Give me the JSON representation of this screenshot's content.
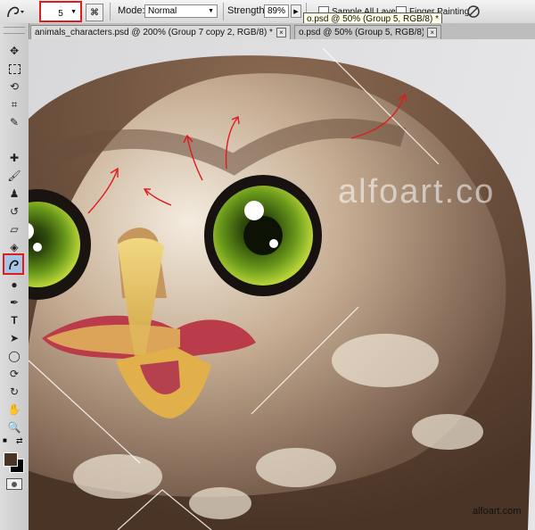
{
  "options_bar": {
    "brush_size": "5",
    "mode_label": "Mode:",
    "mode_value": "Normal",
    "strength_label": "Strength:",
    "strength_value": "89%",
    "sample_all_layers": "Sample All Layers",
    "finger_painting": "Finger Painting"
  },
  "tooltip": "o.psd @ 50% (Group 5, RGB/8) *",
  "tabs": [
    {
      "label": "animals_characters.psd @ 200% (Group 7 copy 2, RGB/8) *"
    },
    {
      "label": "o.psd @ 50% (Group 5, RGB/8) *"
    }
  ],
  "tab_close": "×",
  "canvas": {
    "watermark": "alfoart.co",
    "credit": "alfoart.com"
  },
  "colors": {
    "highlight": "#e01b1b",
    "foreground": "#4a3426",
    "background": "#000000",
    "iris": "#6a9a1a"
  },
  "toolbox_icons": [
    "move-icon",
    "marquee-icon",
    "lasso-icon",
    "crop-icon",
    "eyedropper-icon",
    "healing-icon",
    "brush-icon",
    "stamp-icon",
    "history-brush-icon",
    "eraser-icon",
    "paint-bucket-icon",
    "smudge-icon",
    "dodge-icon",
    "pen-icon",
    "type-icon",
    "path-select-icon",
    "shape-icon",
    "3d-rotate-icon",
    "3d-orbit-icon",
    "hand-icon",
    "zoom-icon"
  ]
}
